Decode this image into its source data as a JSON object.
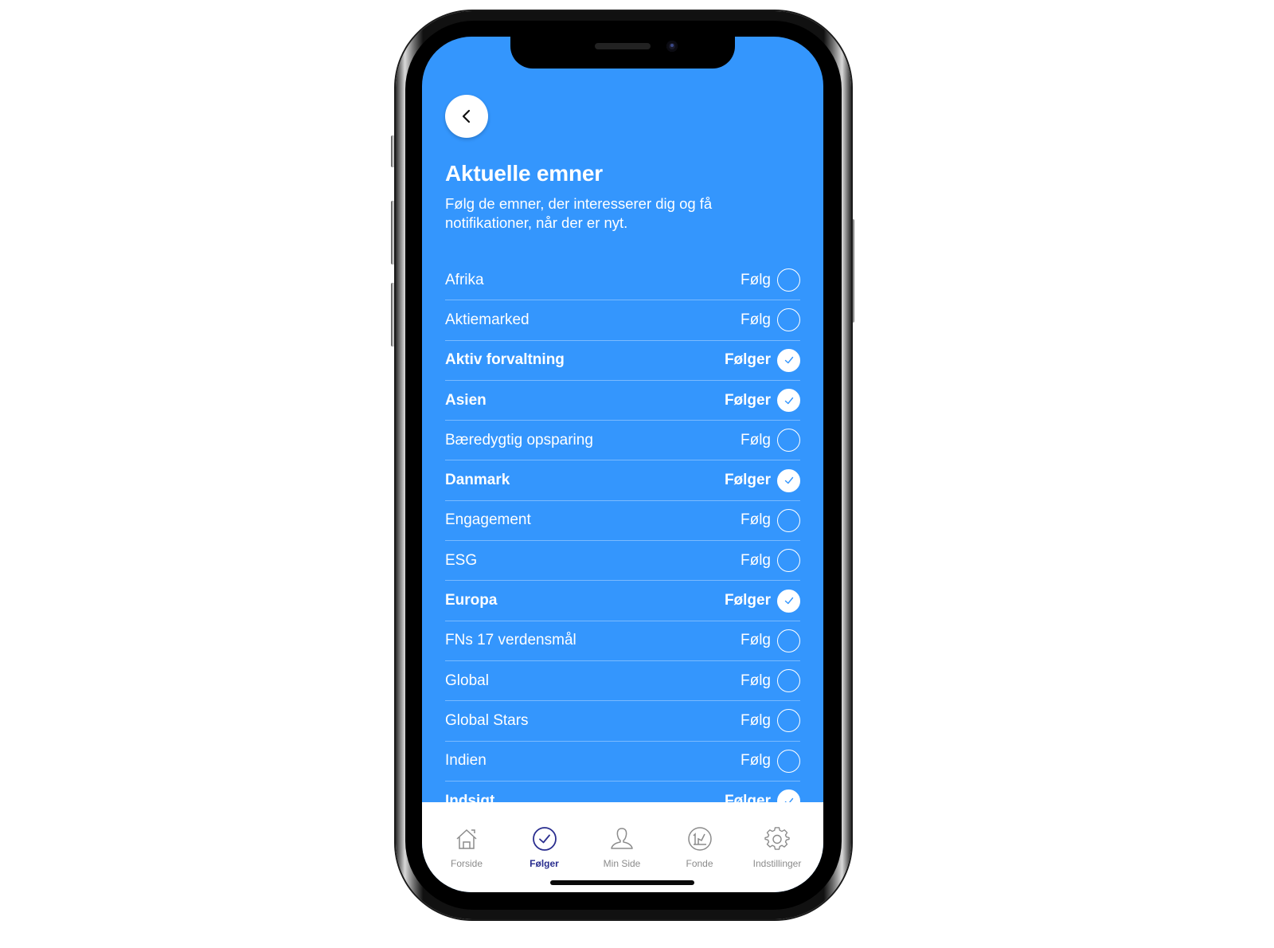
{
  "header": {
    "back_label": "Tilbage",
    "title": "Aktuelle emner",
    "subtitle": "Følg de emner, der interesserer dig og få notifikationer, når der er nyt."
  },
  "colors": {
    "background": "#3496fd",
    "tab_active": "#2a2e8f",
    "tab_inactive": "#8b8b8b"
  },
  "topics": [
    {
      "name": "Afrika",
      "state": "Følg",
      "following": false
    },
    {
      "name": "Aktiemarked",
      "state": "Følg",
      "following": false
    },
    {
      "name": "Aktiv forvaltning",
      "state": "Følger",
      "following": true
    },
    {
      "name": "Asien",
      "state": "Følger",
      "following": true
    },
    {
      "name": "Bæredygtig opsparing",
      "state": "Følg",
      "following": false
    },
    {
      "name": "Danmark",
      "state": "Følger",
      "following": true
    },
    {
      "name": "Engagement",
      "state": "Følg",
      "following": false
    },
    {
      "name": "ESG",
      "state": "Følg",
      "following": false
    },
    {
      "name": "Europa",
      "state": "Følger",
      "following": true
    },
    {
      "name": "FNs 17 verdensmål",
      "state": "Følg",
      "following": false
    },
    {
      "name": "Global",
      "state": "Følg",
      "following": false
    },
    {
      "name": "Global Stars",
      "state": "Følg",
      "following": false
    },
    {
      "name": "Indien",
      "state": "Følg",
      "following": false
    },
    {
      "name": "Indsigt",
      "state": "Følger",
      "following": true
    }
  ],
  "tabbar": {
    "items": [
      {
        "label": "Forside",
        "icon": "home-icon",
        "active": false
      },
      {
        "label": "Følger",
        "icon": "check-circle-icon",
        "active": true
      },
      {
        "label": "Min Side",
        "icon": "person-icon",
        "active": false
      },
      {
        "label": "Fonde",
        "icon": "chart-circle-icon",
        "active": false
      },
      {
        "label": "Indstillinger",
        "icon": "gear-icon",
        "active": false
      }
    ]
  }
}
